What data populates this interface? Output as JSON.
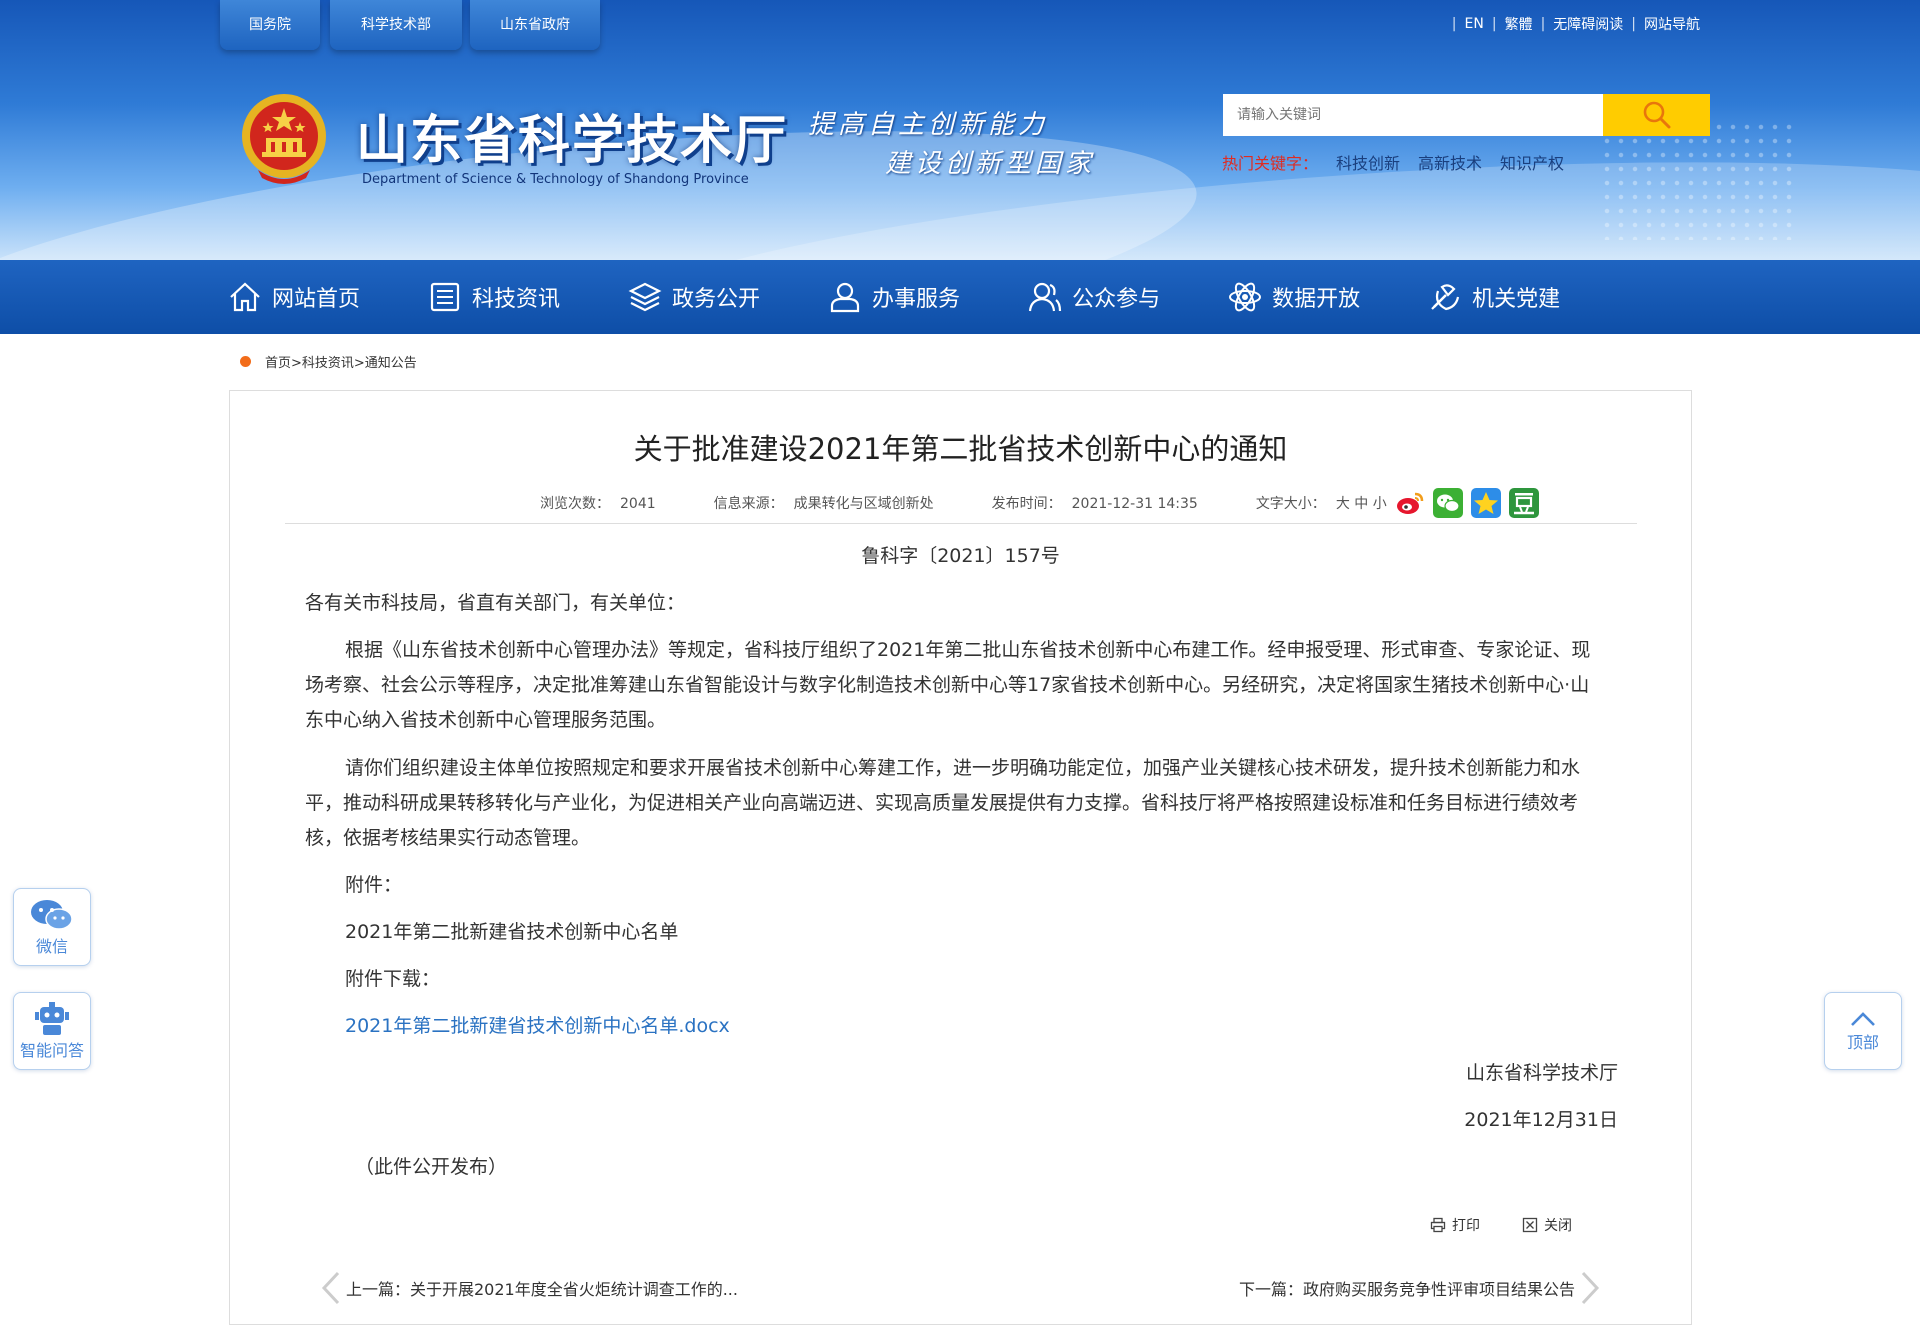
{
  "header": {
    "top_tabs": [
      "国务院",
      "科学技术部",
      "山东省政府"
    ],
    "top_links": [
      "EN",
      "繁體",
      "无障碍阅读",
      "网站导航"
    ],
    "title_cn": "山东省科学技术厅",
    "title_en": "Department of Science & Technology of Shandong Province",
    "slogan_line1": "提高自主创新能力",
    "slogan_line2": "建设创新型国家",
    "search_placeholder": "请输入关键词",
    "hot_label": "热门关键字：",
    "hot_words": [
      "科技创新",
      "高新技术",
      "知识产权"
    ]
  },
  "nav": {
    "items": [
      {
        "label": "网站首页",
        "icon": "home-icon"
      },
      {
        "label": "科技资讯",
        "icon": "news-icon"
      },
      {
        "label": "政务公开",
        "icon": "layers-icon"
      },
      {
        "label": "办事服务",
        "icon": "user-icon"
      },
      {
        "label": "公众参与",
        "icon": "people-icon"
      },
      {
        "label": "数据开放",
        "icon": "atom-icon"
      },
      {
        "label": "机关党建",
        "icon": "party-icon"
      }
    ]
  },
  "breadcrumb": {
    "text": "首页>科技资讯>通知公告"
  },
  "article": {
    "title": "关于批准建设2021年第二批省技术创新中心的通知",
    "views_label": "浏览次数：",
    "views": "2041",
    "source_label": "信息来源：",
    "source": "成果转化与区域创新处",
    "time_label": "发布时间：",
    "time": "2021-12-31 14:35",
    "fontsize_label": "文字大小：",
    "fontsize_options": [
      "大",
      "中",
      "小"
    ],
    "doc_no": "鲁科字〔2021〕157号",
    "salute": "各有关市科技局，省直有关部门，有关单位：",
    "p1": "根据《山东省技术创新中心管理办法》等规定，省科技厅组织了2021年第二批山东省技术创新中心布建工作。经申报受理、形式审查、专家论证、现场考察、社会公示等程序，决定批准筹建山东省智能设计与数字化制造技术创新中心等17家省技术创新中心。另经研究，决定将国家生猪技术创新中心·山东中心纳入省技术创新中心管理服务范围。",
    "p2": "请你们组织建设主体单位按照规定和要求开展省技术创新中心筹建工作，进一步明确功能定位，加强产业关键核心技术研发，提升技术创新能力和水平，推动科研成果转移转化与产业化，为促进相关产业向高端迈进、实现高质量发展提供有力支撑。省科技厅将严格按照建设标准和任务目标进行绩效考核，依据考核结果实行动态管理。",
    "attachment_label": "附件：",
    "attachment_name": "2021年第二批新建省技术创新中心名单",
    "download_label": "附件下载：",
    "download_link": "2021年第二批新建省技术创新中心名单.docx",
    "sign_org": "山东省科学技术厅",
    "sign_date": "2021年12月31日",
    "public_note": "（此件公开发布）",
    "print_label": "打印",
    "close_label": "关闭",
    "prev": "上一篇：关于开展2021年度全省火炬统计调查工作的...",
    "next": "下一篇：政府购买服务竞争性评审项目结果公告"
  },
  "floating": {
    "wechat": "微信",
    "qa": "智能问答",
    "top": "顶部"
  },
  "colors": {
    "brand_blue": "#1657b8",
    "nav_blue": "#0e4ea7",
    "search_yellow": "#ffcc00",
    "hot_red": "#e02b20",
    "link_blue": "#2a72c2",
    "breadcrumb_dot": "#f26c1a"
  }
}
